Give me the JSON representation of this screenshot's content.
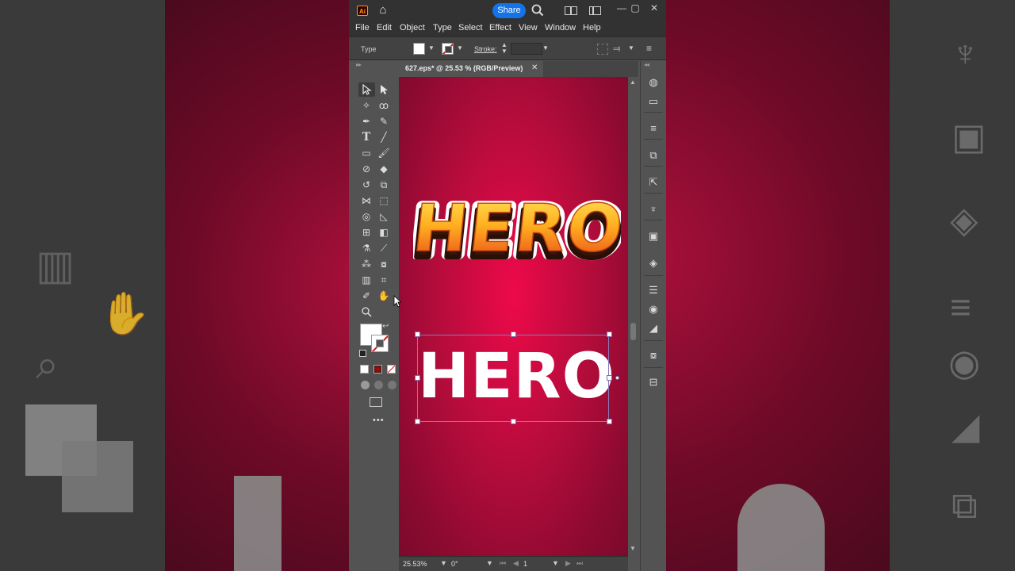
{
  "app": {
    "logo_text": "Ai",
    "share_label": "Share",
    "window_controls": [
      "—",
      "▢",
      "✕"
    ]
  },
  "menu": {
    "items": [
      "File",
      "Edit",
      "Object",
      "Type",
      "Select",
      "Effect",
      "View",
      "Window",
      "Help"
    ]
  },
  "control_bar": {
    "context_label": "Type",
    "fill_color": "#ffffff",
    "stroke_label": "Stroke:",
    "stroke_value": ""
  },
  "document": {
    "tab_title": "627.eps* @ 25.53 % (RGB/Preview)",
    "close_label": "✕"
  },
  "artwork": {
    "styled_text": "HERO",
    "plain_text": "HERO",
    "canvas_colors": {
      "center": "#ee0a4a",
      "edge": "#7a0a2c"
    },
    "styled_fill_colors": [
      "#ffd84a",
      "#ff9a1a",
      "#e8421a"
    ]
  },
  "status_bar": {
    "zoom": "25.53%",
    "rotation": "0°",
    "artboard": "1"
  },
  "toolbar": {
    "more_label": "•••"
  }
}
